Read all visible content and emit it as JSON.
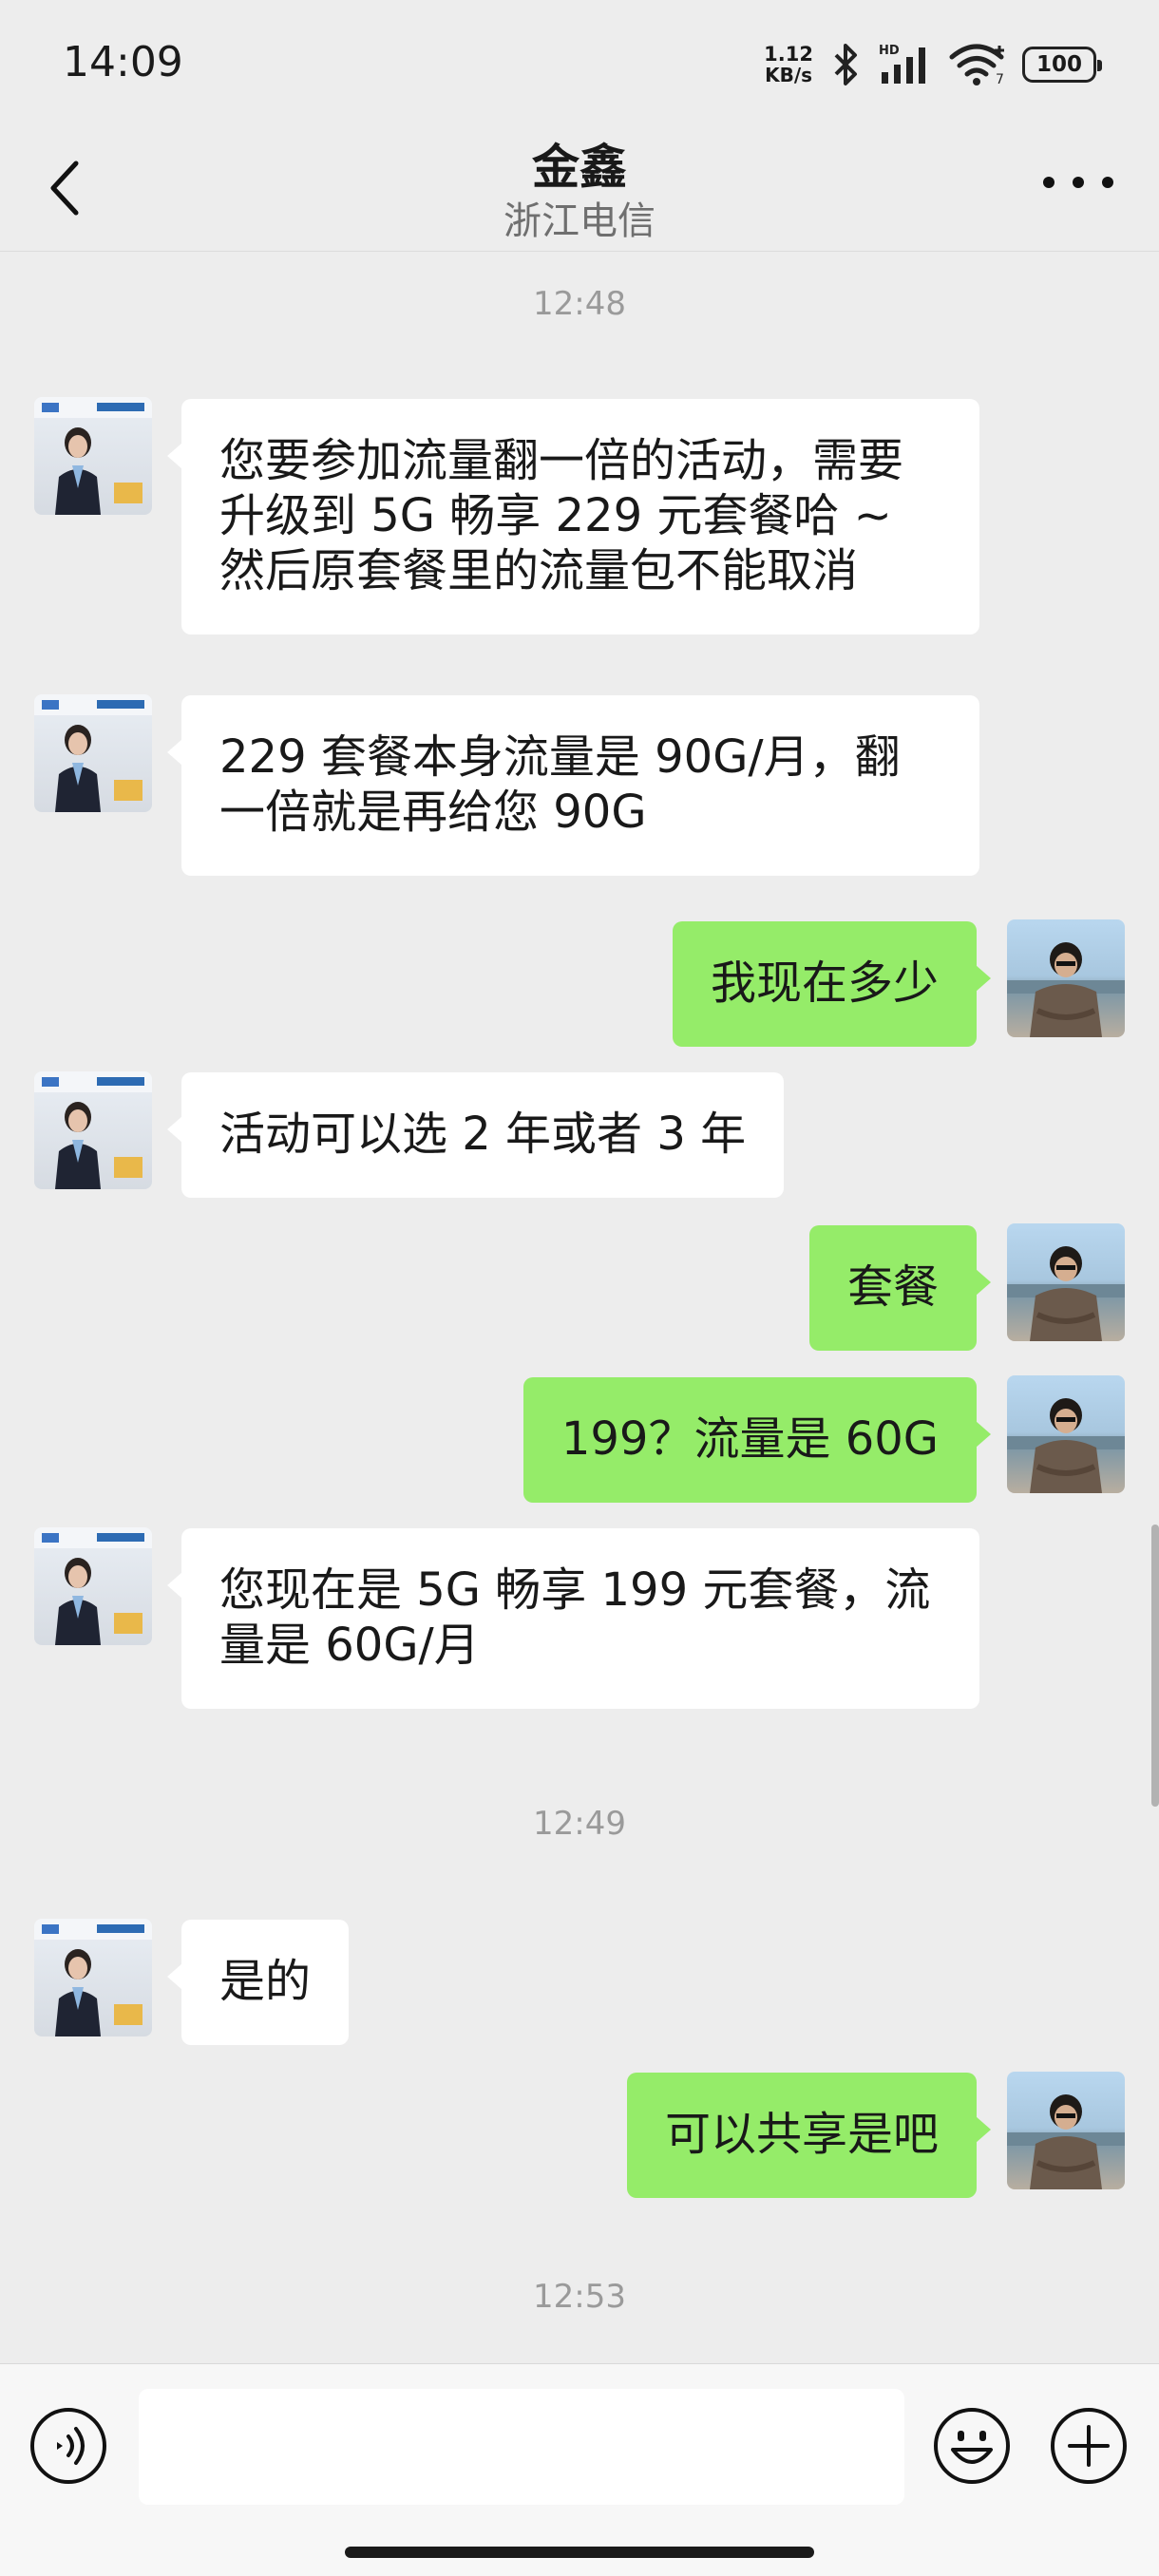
{
  "status_bar": {
    "time": "14:09",
    "net_speed_value": "1.12",
    "net_speed_unit": "KB/s",
    "signal_label": "HD",
    "wifi_label": "7",
    "battery": "100"
  },
  "header": {
    "title": "金鑫",
    "subtitle": "浙江电信"
  },
  "messages": [
    {
      "type": "timestamp",
      "text": "12:48"
    },
    {
      "type": "msg",
      "side": "left",
      "text": "您要参加流量翻一倍的活动，需要升级到 5G 畅享 229 元套餐哈 ~ 然后原套餐里的流量包不能取消"
    },
    {
      "type": "msg",
      "side": "left",
      "text": "229 套餐本身流量是 90G/月，翻一倍就是再给您 90G"
    },
    {
      "type": "msg",
      "side": "right",
      "text": "我现在多少"
    },
    {
      "type": "msg",
      "side": "left",
      "text": "活动可以选 2 年或者 3 年"
    },
    {
      "type": "msg",
      "side": "right",
      "text": "套餐"
    },
    {
      "type": "msg",
      "side": "right",
      "text": "199？流量是 60G"
    },
    {
      "type": "msg",
      "side": "left",
      "text": "您现在是 5G 畅享 199 元套餐，流量是 60G/月"
    },
    {
      "type": "timestamp",
      "text": "12:49"
    },
    {
      "type": "msg",
      "side": "left",
      "text": "是的"
    },
    {
      "type": "msg",
      "side": "right",
      "text": "可以共享是吧"
    },
    {
      "type": "timestamp",
      "text": "12:53"
    }
  ],
  "input_bar": {
    "value": "",
    "icons": [
      "voice-icon",
      "emoji-icon",
      "plus-icon"
    ]
  },
  "colors": {
    "background": "#ededed",
    "sent_bubble": "#95ec69",
    "received_bubble": "#ffffff",
    "timestamp": "#9a9a9a"
  }
}
